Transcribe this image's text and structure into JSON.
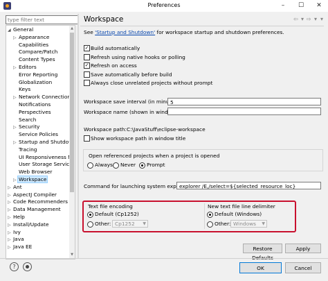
{
  "window": {
    "title": "Preferences",
    "controls": [
      "–",
      "☐",
      "✕"
    ]
  },
  "sidebar": {
    "filter_placeholder": "type filter text",
    "tree": [
      {
        "label": "General",
        "level": 0,
        "expanded": true
      },
      {
        "label": "Appearance",
        "level": 1,
        "expanded": false
      },
      {
        "label": "Capabilities",
        "level": 1
      },
      {
        "label": "Compare/Patch",
        "level": 1
      },
      {
        "label": "Content Types",
        "level": 1
      },
      {
        "label": "Editors",
        "level": 1,
        "expanded": false
      },
      {
        "label": "Error Reporting",
        "level": 1
      },
      {
        "label": "Globalization",
        "level": 1
      },
      {
        "label": "Keys",
        "level": 1
      },
      {
        "label": "Network Connection",
        "level": 1,
        "expanded": false
      },
      {
        "label": "Notifications",
        "level": 1
      },
      {
        "label": "Perspectives",
        "level": 1
      },
      {
        "label": "Search",
        "level": 1
      },
      {
        "label": "Security",
        "level": 1,
        "expanded": false
      },
      {
        "label": "Service Policies",
        "level": 1
      },
      {
        "label": "Startup and Shutdown",
        "level": 1,
        "expanded": false
      },
      {
        "label": "Tracing",
        "level": 1
      },
      {
        "label": "UI Responsiveness M",
        "level": 1
      },
      {
        "label": "User Storage Service",
        "level": 1
      },
      {
        "label": "Web Browser",
        "level": 1
      },
      {
        "label": "Workspace",
        "level": 1,
        "expanded": false,
        "selected": true
      },
      {
        "label": "Ant",
        "level": 0,
        "expanded": false
      },
      {
        "label": "AspectJ Compiler",
        "level": 0,
        "expanded": false
      },
      {
        "label": "Code Recommenders",
        "level": 0,
        "expanded": false
      },
      {
        "label": "Data Management",
        "level": 0,
        "expanded": false
      },
      {
        "label": "Help",
        "level": 0,
        "expanded": false
      },
      {
        "label": "Install/Update",
        "level": 0,
        "expanded": false
      },
      {
        "label": "Ivy",
        "level": 0,
        "expanded": false
      },
      {
        "label": "Java",
        "level": 0,
        "expanded": false
      },
      {
        "label": "Java EE",
        "level": 0,
        "expanded": false
      }
    ]
  },
  "main": {
    "heading": "Workspace",
    "nav": {
      "back": "⇦",
      "dd1": "▾",
      "forward": "⇨",
      "dd2": "▾",
      "menu": "▾"
    },
    "intro_prefix": "See ",
    "intro_link": "'Startup and Shutdown'",
    "intro_suffix": " for workspace startup and shutdown preferences.",
    "checkboxes": [
      {
        "label": "Build automatically",
        "checked": true
      },
      {
        "label": "Refresh using native hooks or polling",
        "checked": false
      },
      {
        "label": "Refresh on access",
        "checked": true
      },
      {
        "label": "Save automatically before build",
        "checked": false
      },
      {
        "label": "Always close unrelated projects without prompt",
        "checked": false
      }
    ],
    "save_interval_label": "Workspace save interval (in minutes):",
    "save_interval_value": "5",
    "ws_name_label": "Workspace name (shown in window title):",
    "ws_name_value": "",
    "ws_path_label": "Workspace path:",
    "ws_path_value": "C:\\JavaStuff\\eclipse-workspace",
    "show_path_label": "Show workspace path in window title",
    "show_path_checked": false,
    "open_ref": {
      "title": "Open referenced projects when a project is opened",
      "options": [
        "Always",
        "Never",
        "Prompt"
      ],
      "selected": "Prompt"
    },
    "explorer_label": "Command for launching system explorer:",
    "explorer_value": "explorer /E,/select=${selected_resource_loc}",
    "encoding": {
      "title": "Text file encoding",
      "default_label": "Default (Cp1252)",
      "other_label": "Other:",
      "other_value": "Cp1252",
      "selected": "default"
    },
    "delimiter": {
      "title": "New text file line delimiter",
      "default_label": "Default (Windows)",
      "other_label": "Other:",
      "other_value": "Windows",
      "selected": "default"
    },
    "restore_defaults": "Restore Defaults",
    "apply": "Apply"
  },
  "footer": {
    "help_icon": "?",
    "ok": "OK",
    "cancel": "Cancel"
  },
  "colors": {
    "highlight_border": "#c8102e",
    "selection": "#cce8ff",
    "link": "#0645ad"
  }
}
